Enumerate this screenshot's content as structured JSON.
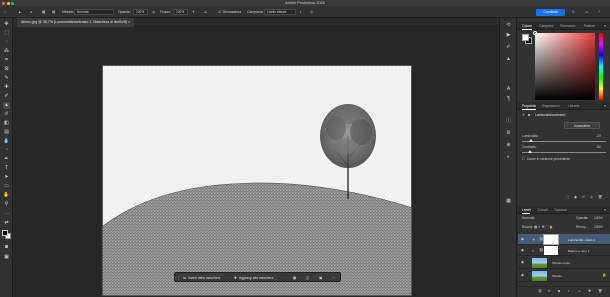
{
  "app": {
    "title": "Adobe Photoshop 2026"
  },
  "options_bar": {
    "blend_label": "Metodo:",
    "blend_value": "Normale",
    "opacity_label": "Opacità:",
    "opacity_value": "100%",
    "flow_label": "Flusso:",
    "flow_value": "100%",
    "smoothing_label": "Smussatura",
    "sample_label": "Campiona:",
    "sample_value": "Livello attuale",
    "share_label": "Condividi"
  },
  "document": {
    "tab_label": "Albero.jpg @ 36,7% (Luminosità/contrasto 1, Maschera di livello/8) ×"
  },
  "context_bar": {
    "invert_label": "Inverti della maschera",
    "add_label": "Aggiungi alla maschera"
  },
  "color_panel": {
    "tabs": [
      "Colore",
      "Campioni",
      "Sfumature",
      "Pattern"
    ],
    "active_tab": 0,
    "hue_color": "#e83a3a"
  },
  "properties_panel": {
    "tabs": [
      "Proprietà",
      "Regolazioni",
      "Librerie"
    ],
    "active_tab": 0,
    "adjustment_name": "Luminosità/contrasto",
    "auto_label": "Automatico",
    "brightness_label": "Luminosità",
    "brightness_value": "-24",
    "contrast_label": "Contrasto",
    "contrast_value": "-92",
    "legacy_label": "Come in versione precedente"
  },
  "layers_panel": {
    "tabs": [
      "Livelli",
      "Canali",
      "Tracciati"
    ],
    "active_tab": 0,
    "blend_value": "Normale",
    "opacity_label": "Opacità:",
    "opacity_value": "100%",
    "lock_label": "Blocca:",
    "fill_label": "Riemp.:",
    "fill_value": "100%",
    "layers": [
      {
        "name": "Luminosità...rasto 1",
        "selected": true
      },
      {
        "name": "Bianco e nero 1",
        "selected": false
      },
      {
        "name": "Sfondo copia",
        "selected": false
      },
      {
        "name": "Sfondo",
        "selected": false
      }
    ]
  }
}
